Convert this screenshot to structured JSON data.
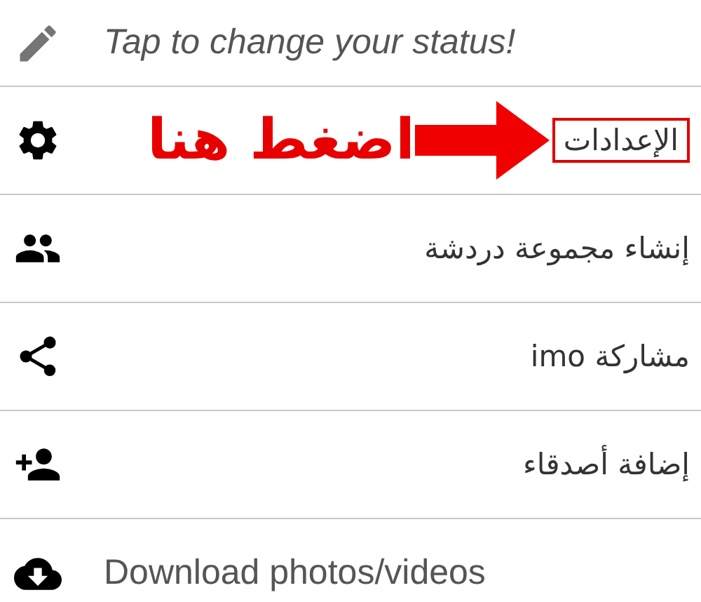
{
  "items": [
    {
      "kind": "status",
      "label": "Tap to change your status!"
    },
    {
      "kind": "settings",
      "label": "الإعدادات",
      "highlight": true,
      "note": "اضغط هنا"
    },
    {
      "kind": "group",
      "label": "إنشاء مجموعة دردشة"
    },
    {
      "kind": "share",
      "label": "مشاركة imo"
    },
    {
      "kind": "add-friend",
      "label": "إضافة أصدقاء"
    },
    {
      "kind": "download",
      "label": "Download photos/videos"
    }
  ]
}
